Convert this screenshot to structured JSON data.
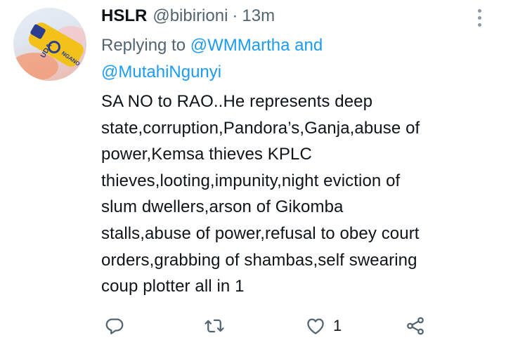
{
  "tweet": {
    "author_name": "HSLR",
    "author_handle": "@bibirioni",
    "separator": "·",
    "timestamp": "13m",
    "avatar_text": "UDA",
    "avatar_text2": "NGANO",
    "replying_prefix": "Replying to",
    "mention_1": "@WMMartha",
    "replying_and": "and",
    "mention_2": "@MutahiNgunyi",
    "body_lines": [
      "SA NO to RAO..He represents deep",
      "state,corruption,Pandora’s,Ganja,abuse of",
      "power,Kemsa thieves KPLC",
      "thieves,looting,impunity,night eviction of",
      "slum dwellers,arson of Gikomba",
      "stalls,abuse of power,refusal to obey court",
      "orders,grabbing of shambas,self swearing",
      "coup plotter all in 1"
    ],
    "like_count": "1"
  },
  "icons": {
    "more": "more-icon",
    "reply": "reply-icon",
    "retweet": "retweet-icon",
    "like": "heart-icon",
    "share": "share-icon"
  },
  "colors": {
    "text": "#0f1419",
    "secondary": "#536471",
    "link": "#1d9bf0"
  }
}
